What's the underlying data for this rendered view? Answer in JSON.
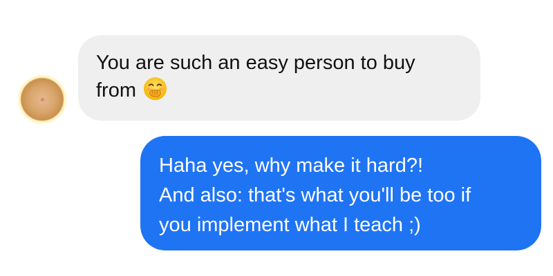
{
  "conversation": {
    "incoming": {
      "avatar_icon": "blurred-profile-avatar",
      "lines": [
        "You are such an easy person to buy",
        "from"
      ],
      "emoji_icon": "face-with-hand-over-mouth-icon",
      "bubble_color": "#efefef"
    },
    "outgoing": {
      "lines": [
        "Haha yes, why make it hard?!",
        "And also: that's what you'll be too if",
        "you implement what I teach ;)"
      ],
      "bubble_color": "#1f74f4"
    }
  }
}
